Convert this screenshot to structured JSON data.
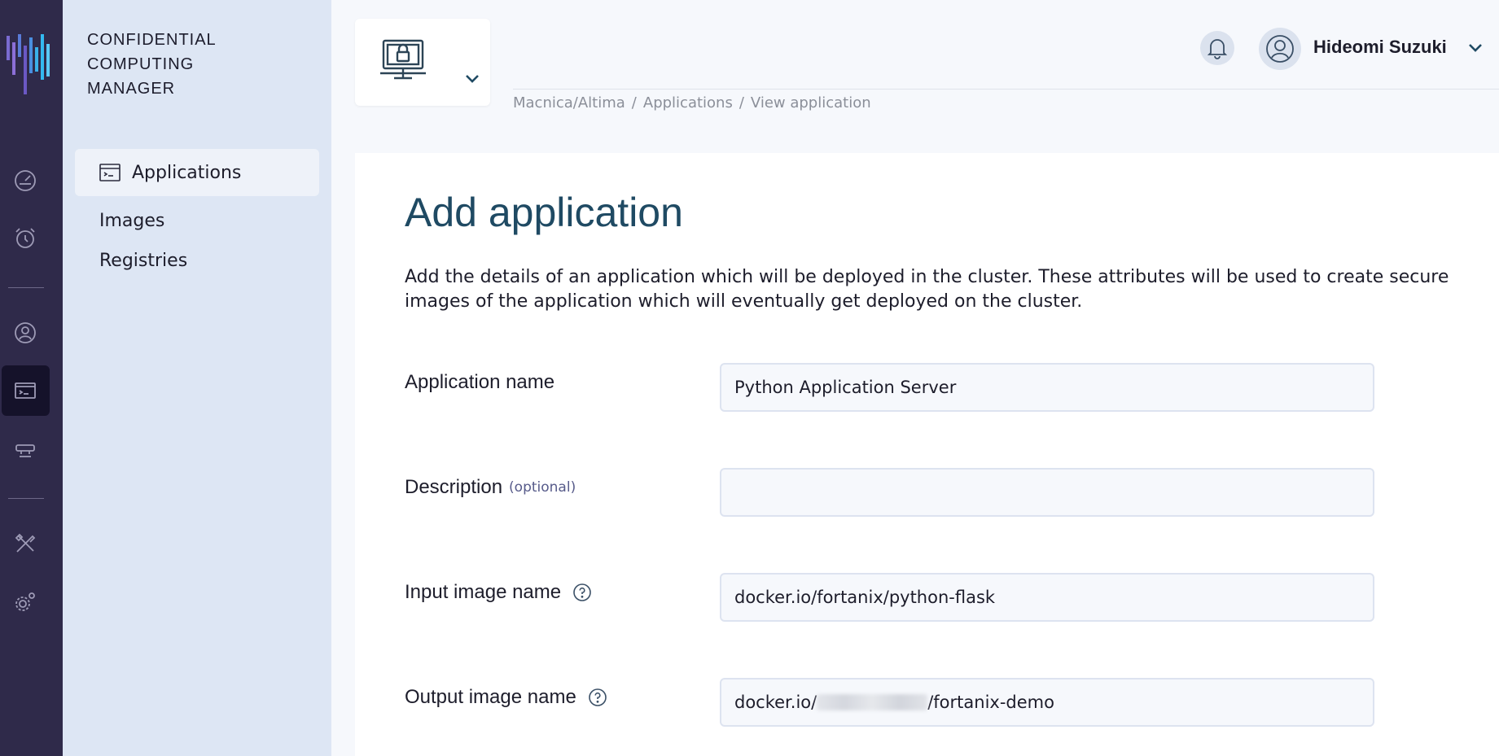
{
  "app": {
    "brand_lines": [
      "CONFIDENTIAL",
      "COMPUTING",
      "MANAGER"
    ]
  },
  "rail": {
    "icons": [
      "dashboard-icon",
      "alarm-clock-icon",
      "user-icon",
      "applications-icon",
      "nodes-icon",
      "tools-icon",
      "settings-icon"
    ],
    "active": "applications-icon"
  },
  "sidebar": {
    "items": [
      {
        "label": "Applications",
        "active": true
      },
      {
        "label": "Images",
        "active": false
      },
      {
        "label": "Registries",
        "active": false
      }
    ]
  },
  "header": {
    "user_name": "Hideomi Suzuki",
    "breadcrumb": [
      "Macnica/Altima",
      "Applications",
      "View application"
    ]
  },
  "main": {
    "title": "Add application",
    "description": "Add the details of an application which will be deployed in the cluster. These attributes will be used to create secure images of the application which will eventually get deployed on the cluster.",
    "fields": {
      "app_name": {
        "label": "Application name",
        "value": "Python Application Server"
      },
      "description": {
        "label": "Description",
        "optional": "(optional)",
        "value": ""
      },
      "input_image": {
        "label": "Input image name",
        "value": "docker.io/fortanix/python-flask"
      },
      "output_image": {
        "label": "Output image name",
        "prefix": "docker.io/",
        "suffix": "/fortanix-demo"
      }
    }
  },
  "colors": {
    "rail_bg": "#2f2a4a",
    "sidebar_bg": "#dde6f4",
    "title": "#1f4a63",
    "accent": "#1f4a63"
  }
}
